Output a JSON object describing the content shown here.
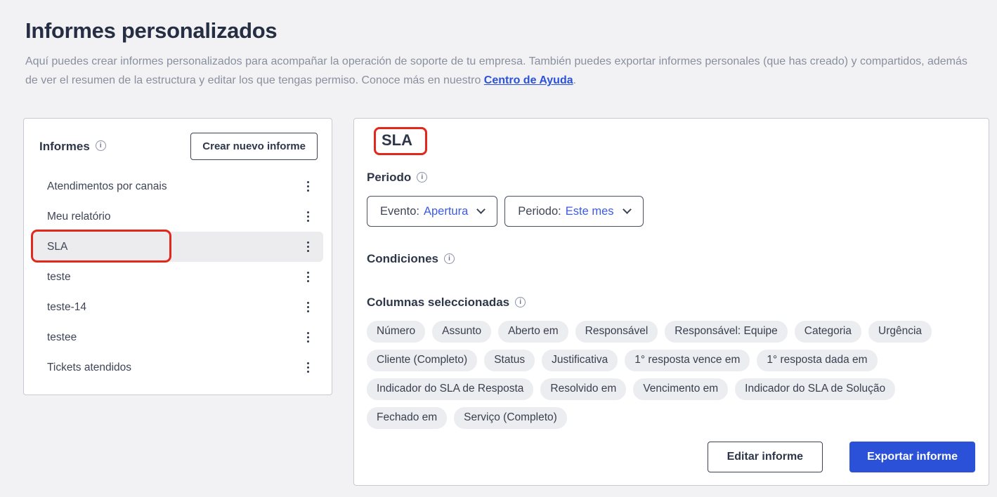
{
  "page": {
    "title": "Informes personalizados",
    "subtitle_before_link": "Aquí puedes crear informes personalizados para acompañar la operación de soporte de tu empresa. También puedes exportar informes personales (que has creado) y compartidos, además de ver el resumen de la estructura y editar los que tengas permiso. Conoce más en nuestro ",
    "subtitle_link": "Centro de Ayuda",
    "subtitle_after_link": "."
  },
  "icons": {
    "info": "i"
  },
  "sidebar": {
    "title": "Informes",
    "create_button": "Crear nuevo informe",
    "items": [
      {
        "label": "Atendimentos por canais",
        "selected": false,
        "annotated": false
      },
      {
        "label": "Meu relatório",
        "selected": false,
        "annotated": false
      },
      {
        "label": "SLA",
        "selected": true,
        "annotated": true
      },
      {
        "label": "teste",
        "selected": false,
        "annotated": false
      },
      {
        "label": "teste-14",
        "selected": false,
        "annotated": false
      },
      {
        "label": "testee",
        "selected": false,
        "annotated": false
      },
      {
        "label": "Tickets atendidos",
        "selected": false,
        "annotated": false
      }
    ]
  },
  "detail": {
    "title": "SLA",
    "period_label": "Periodo",
    "filters": [
      {
        "prefix": "Evento:",
        "value": "Apertura"
      },
      {
        "prefix": "Periodo:",
        "value": "Este mes"
      }
    ],
    "conditions_label": "Condiciones",
    "columns_label": "Columnas seleccionadas",
    "columns": [
      "Número",
      "Assunto",
      "Aberto em",
      "Responsável",
      "Responsável: Equipe",
      "Categoria",
      "Urgência",
      "Cliente (Completo)",
      "Status",
      "Justificativa",
      "1° resposta vence em",
      "1° resposta dada em",
      "Indicador do SLA de Resposta",
      "Resolvido em",
      "Vencimento em",
      "Indicador do SLA de Solução",
      "Fechado em",
      "Serviço (Completo)"
    ],
    "edit_button": "Editar informe",
    "export_button": "Exportar informe"
  },
  "colors": {
    "accent_blue": "#2B51D8",
    "dropdown_value_blue": "#3D5AE8",
    "annotation_red": "#E2271C",
    "heading_dark": "#252E42",
    "subtitle_gray": "#8A8F9E",
    "chip_bg": "#ECEDF0",
    "selected_row_bg": "#ECECEF"
  }
}
